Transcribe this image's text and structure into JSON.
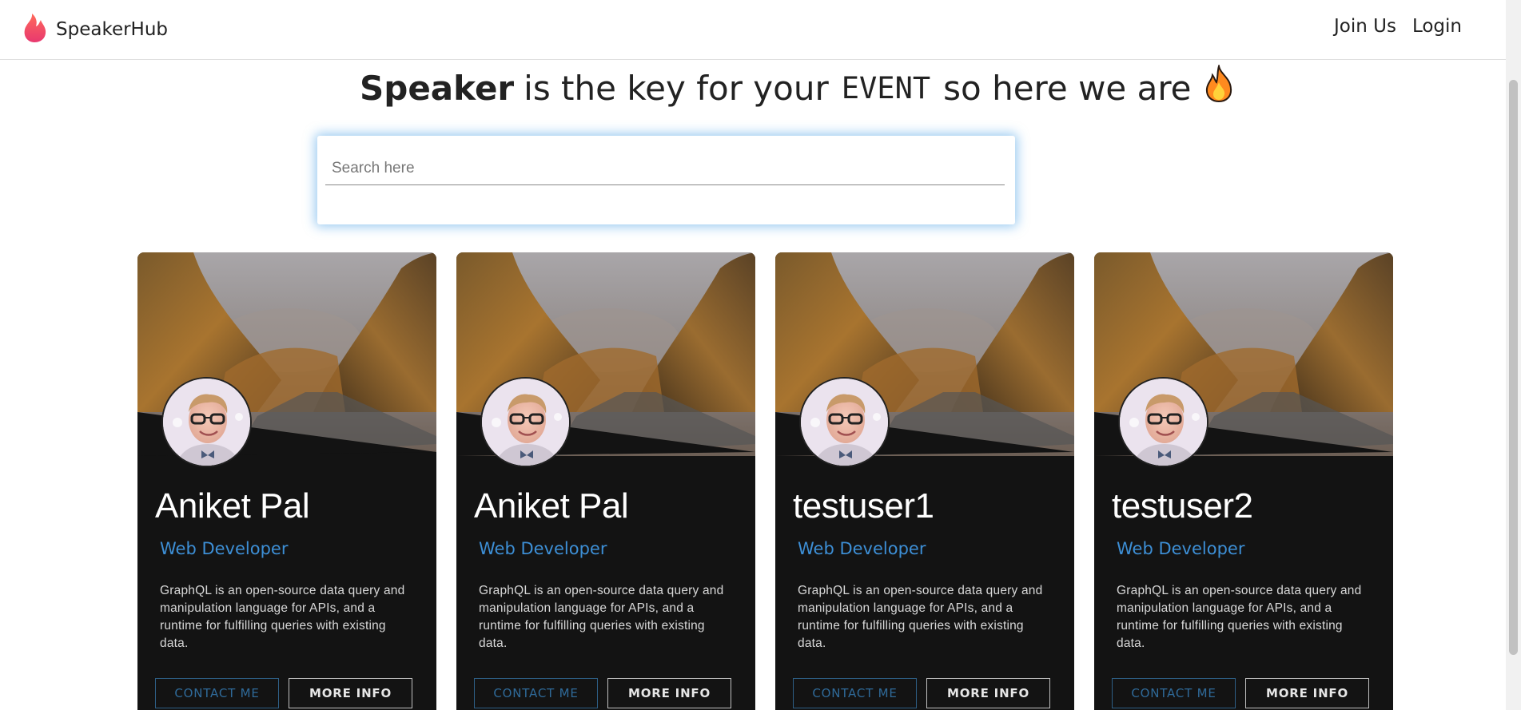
{
  "nav": {
    "brand": "SpeakerHub",
    "links": [
      "Join Us",
      "Login"
    ]
  },
  "hero": {
    "bold": "Speaker",
    "middle": "is the key for your",
    "event": "EVENT",
    "tail": "so here we are",
    "icon": "fire-icon"
  },
  "search": {
    "placeholder": "Search here",
    "value": ""
  },
  "cards": [
    {
      "name": "Aniket Pal",
      "role": "Web Developer",
      "description": "GraphQL is an open-source data query and manipulation language for APIs, and a runtime for fulfilling queries with existing data.",
      "contact_label": "CONTACT ME",
      "more_label": "MORE INFO"
    },
    {
      "name": "Aniket Pal",
      "role": "Web Developer",
      "description": "GraphQL is an open-source data query and manipulation language for APIs, and a runtime for fulfilling queries with existing data.",
      "contact_label": "CONTACT ME",
      "more_label": "MORE INFO"
    },
    {
      "name": "testuser1",
      "role": "Web Developer",
      "description": "GraphQL is an open-source data query and manipulation language for APIs, and a runtime for fulfilling queries with existing data.",
      "contact_label": "CONTACT ME",
      "more_label": "MORE INFO"
    },
    {
      "name": "testuser2",
      "role": "Web Developer",
      "description": "GraphQL is an open-source data query and manipulation language for APIs, and a runtime for fulfilling queries with existing data.",
      "contact_label": "CONTACT ME",
      "more_label": "MORE INFO"
    }
  ],
  "colors": {
    "brand_flame": "#f0476a",
    "role_accent": "#3d8fd6",
    "card_bg": "#131313",
    "search_glow": "#4ba0e6"
  }
}
